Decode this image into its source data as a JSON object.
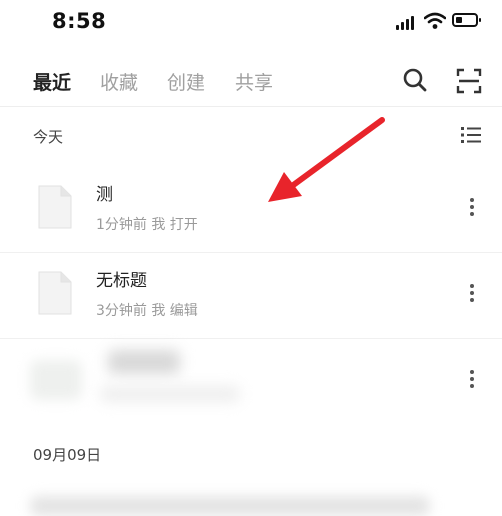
{
  "status_bar": {
    "time": "8:58"
  },
  "tabs": [
    {
      "label": "最近",
      "active": true
    },
    {
      "label": "收藏",
      "active": false
    },
    {
      "label": "创建",
      "active": false
    },
    {
      "label": "共享",
      "active": false
    }
  ],
  "toolbar_icons": [
    "search-icon",
    "scan-icon"
  ],
  "sections": [
    {
      "label": "今天",
      "files": [
        {
          "title": "测",
          "meta": "1分钟前 我 打开"
        },
        {
          "title": "无标题",
          "meta": "3分钟前 我 编辑"
        },
        {
          "title": "",
          "meta": "",
          "blurred": true
        }
      ]
    },
    {
      "label": "09月09日"
    }
  ],
  "colors": {
    "annotation_arrow": "#e8242b",
    "inactive_tab": "#a0a0a0",
    "meta_text": "#9a9a9a"
  }
}
